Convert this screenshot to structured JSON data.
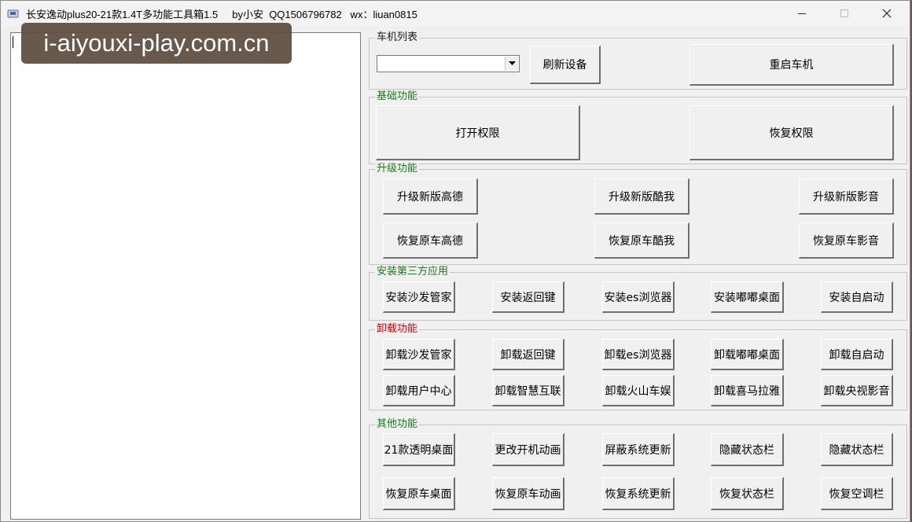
{
  "window": {
    "title": "长安逸动plus20-21款1.4T多功能工具箱1.5     by小安  QQ1506796782   wx：liuan0815"
  },
  "watermark": "i-aiyouxi-play.com.cn",
  "groups": {
    "car_list": {
      "title": "车机列表",
      "combo_value": "",
      "refresh_label": "刷新设备",
      "restart_label": "重启车机"
    },
    "basic": {
      "title": "基础功能",
      "buttons": [
        "打开权限",
        "恢复权限"
      ]
    },
    "upgrade": {
      "title": "升级功能",
      "buttons": [
        "升级新版高德",
        "升级新版酷我",
        "升级新版影音",
        "恢复原车高德",
        "恢复原车酷我",
        "恢复原车影音"
      ]
    },
    "install": {
      "title": "安装第三方应用",
      "buttons": [
        "安装沙发管家",
        "安装返回键",
        "安装es浏览器",
        "安装嘟嘟桌面",
        "安装自启动"
      ]
    },
    "uninstall": {
      "title": "卸载功能",
      "buttons": [
        "卸载沙发管家",
        "卸载返回键",
        "卸载es浏览器",
        "卸载嘟嘟桌面",
        "卸载自启动",
        "卸载用户中心",
        "卸载智慧互联",
        "卸载火山车娱",
        "卸载喜马拉雅",
        "卸载央视影音"
      ]
    },
    "other": {
      "title": "其他功能",
      "buttons": [
        "21款透明桌面",
        "更改开机动画",
        "屏蔽系统更新",
        "隐藏状态栏",
        "隐藏状态栏",
        "恢复原车桌面",
        "恢复原车动画",
        "恢复系统更新",
        "恢复状态栏",
        "恢复空调栏"
      ]
    }
  }
}
